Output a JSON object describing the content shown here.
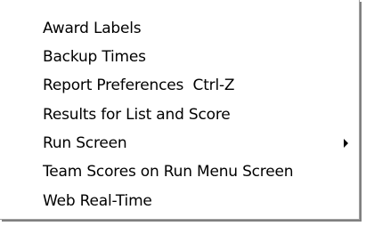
{
  "menu": {
    "items": [
      {
        "label": "Award Labels"
      },
      {
        "label": "Backup Times"
      },
      {
        "label": "Report Preferences  Ctrl-Z"
      },
      {
        "label": "Results for List and Score"
      },
      {
        "label": "Run Screen",
        "submenu_icon": "submenu-arrow-icon"
      },
      {
        "label": "Team Scores on Run Menu Screen"
      },
      {
        "label": "Web Real-Time"
      }
    ]
  }
}
